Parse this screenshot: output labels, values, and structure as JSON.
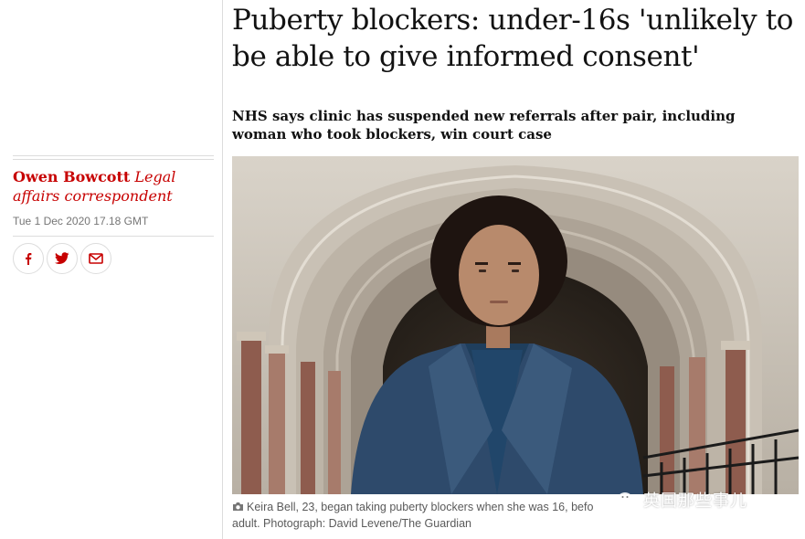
{
  "article": {
    "headline": "Puberty blockers: under-16s 'unlikely to be able to give informed consent'",
    "standfirst": "NHS says clinic has suspended new referrals after pair, including woman who took blockers, win court case"
  },
  "byline": {
    "author": "Owen Bowcott",
    "role": "Legal affairs correspondent",
    "date": "Tue 1 Dec 2020 17.18 GMT"
  },
  "share": {
    "buttons": [
      {
        "name": "facebook",
        "icon": "facebook-icon"
      },
      {
        "name": "twitter",
        "icon": "twitter-icon"
      },
      {
        "name": "email",
        "icon": "email-icon"
      }
    ]
  },
  "photo": {
    "caption": "Keira Bell, 23, began taking puberty blockers when she was 16, befo",
    "caption_line2": "adult. Photograph: David Levene/The Guardian",
    "watermark": "英国那些事儿"
  },
  "colors": {
    "accent": "#c70000",
    "text": "#121212",
    "meta": "#767676",
    "rule": "#dcdcdc"
  }
}
